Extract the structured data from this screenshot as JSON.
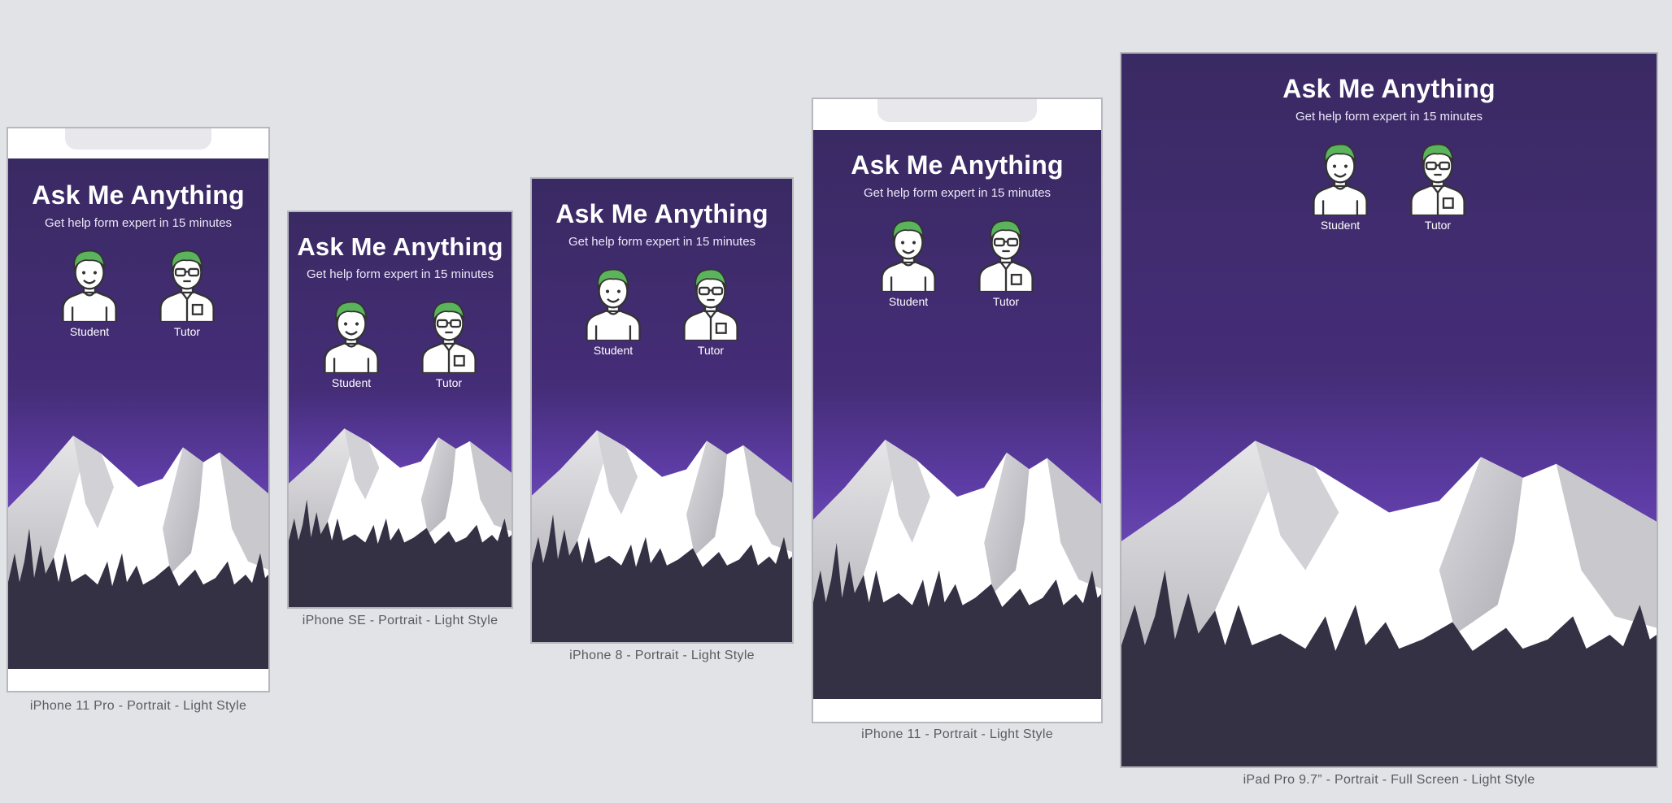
{
  "app": {
    "title": "Ask Me Anything",
    "subtitle": "Get help form expert in 15 minutes",
    "roles": [
      {
        "label": "Student",
        "icon": "student-avatar-icon"
      },
      {
        "label": "Tutor",
        "icon": "tutor-avatar-icon"
      }
    ]
  },
  "devices": [
    {
      "label": "iPhone 11 Pro - Portrait - Light Style"
    },
    {
      "label": "iPhone SE - Portrait - Light Style"
    },
    {
      "label": "iPhone 8 - Portrait - Light Style"
    },
    {
      "label": "iPhone 11 - Portrait - Light Style"
    },
    {
      "label": "iPad Pro 9.7” - Portrait - Full Screen - Light Style"
    }
  ],
  "colors": {
    "canvas": "#e2e3e7",
    "gradient_top": "#3a2a63",
    "gradient_glow": "#6a48b4",
    "hair": "#5bb35c",
    "forest": "#353145"
  }
}
